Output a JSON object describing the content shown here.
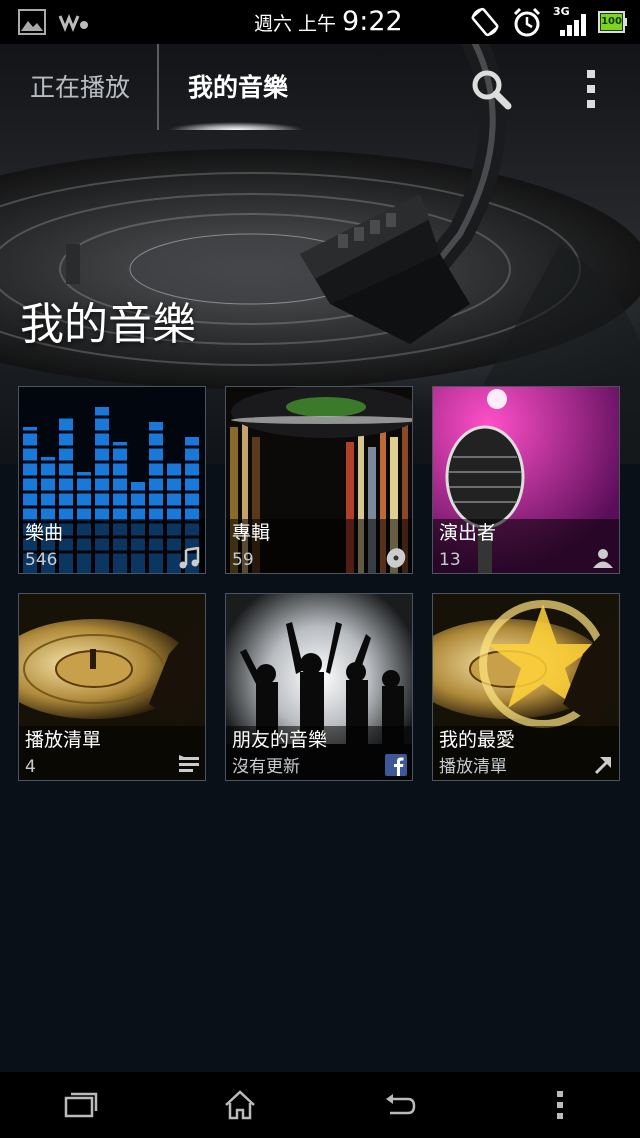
{
  "status_bar": {
    "date_label": "週六 上午",
    "time": "9:22",
    "network": "3G",
    "battery_label": "100",
    "icons": [
      "gallery-icon",
      "walkman-icon",
      "screen-rotate-icon",
      "alarm-icon",
      "signal-icon",
      "battery-icon"
    ]
  },
  "tabs": {
    "now_playing": "正在播放",
    "my_music": "我的音樂",
    "active": "my_music"
  },
  "page": {
    "title": "我的音樂"
  },
  "tiles": [
    {
      "name": "樂曲",
      "sub": "546",
      "icon": "music-note-icon"
    },
    {
      "name": "專輯",
      "sub": "59",
      "icon": "disc-icon"
    },
    {
      "name": "演出者",
      "sub": "13",
      "icon": "person-icon"
    },
    {
      "name": "播放清單",
      "sub": "4",
      "icon": "playlist-icon"
    },
    {
      "name": "朋友的音樂",
      "sub": "沒有更新",
      "icon": "facebook-icon"
    },
    {
      "name": "我的最愛",
      "sub": "播放清單",
      "icon": "shortcut-arrow-icon"
    }
  ],
  "nav": [
    "recent-apps-icon",
    "home-icon",
    "back-icon",
    "menu-icon"
  ]
}
